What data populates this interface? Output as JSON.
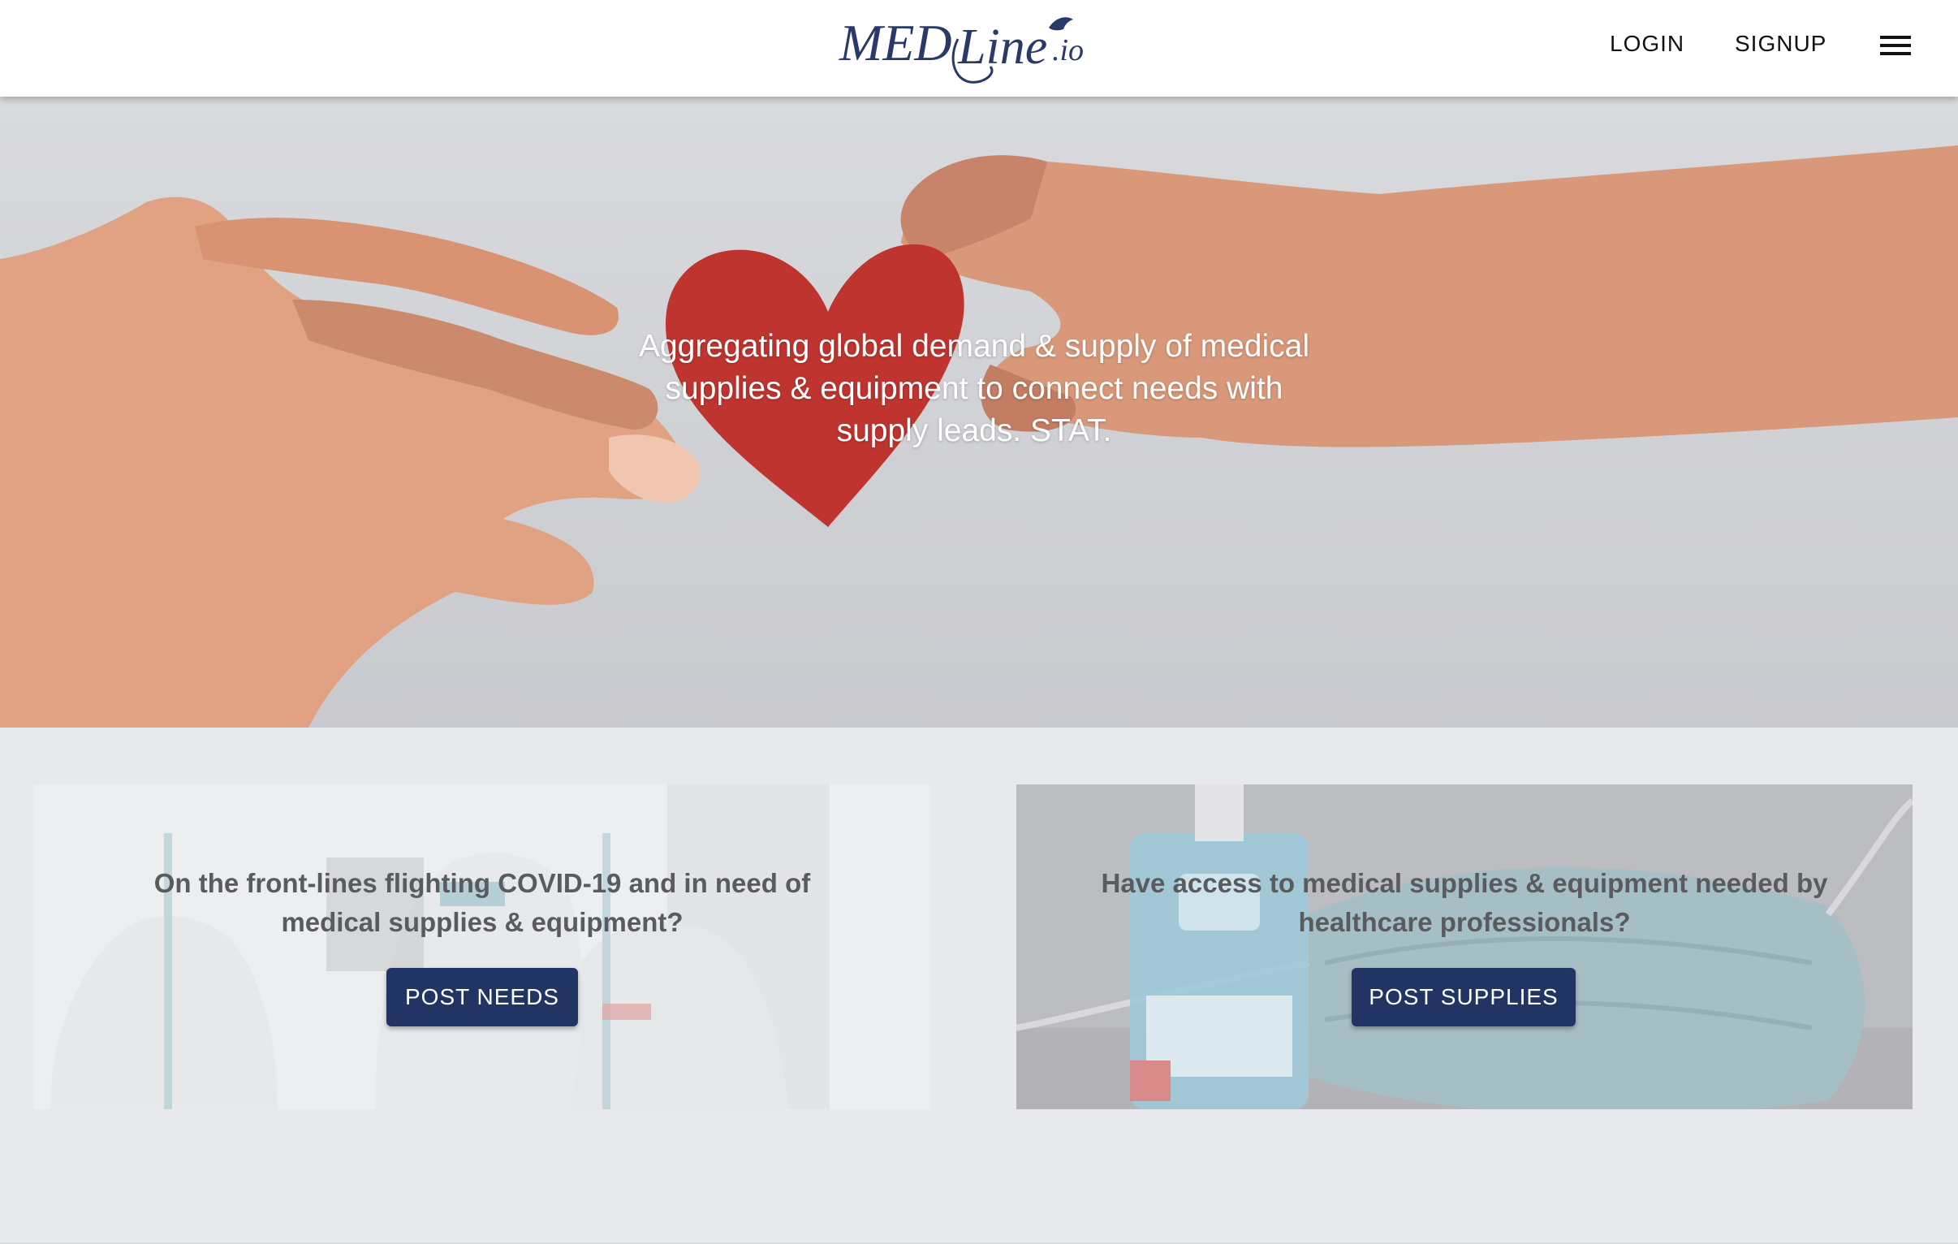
{
  "header": {
    "logo": {
      "text_main": "MED",
      "text_script": "Line",
      "text_suffix": ".io",
      "brand_color": "#2a3a68"
    },
    "nav": {
      "login_label": "LOGIN",
      "signup_label": "SIGNUP"
    },
    "menu_icon": "hamburger-menu-icon"
  },
  "hero": {
    "headline": "Aggregating global demand & supply of medical supplies & equipment to connect needs with supply leads. STAT.",
    "image_subject": "two hands holding a red paper heart",
    "heart_color": "#c0342f"
  },
  "cards": [
    {
      "text": "On the front-lines flighting COVID-19 and in need of medical supplies & equipment?",
      "button_label": "POST NEEDS"
    },
    {
      "text": "Have access to medical supplies & equipment needed by healthcare professionals?",
      "button_label": "POST SUPPLIES"
    }
  ],
  "colors": {
    "button_bg": "#213463",
    "page_bg": "#e8e9ec",
    "card_text": "#5a5b5e"
  }
}
